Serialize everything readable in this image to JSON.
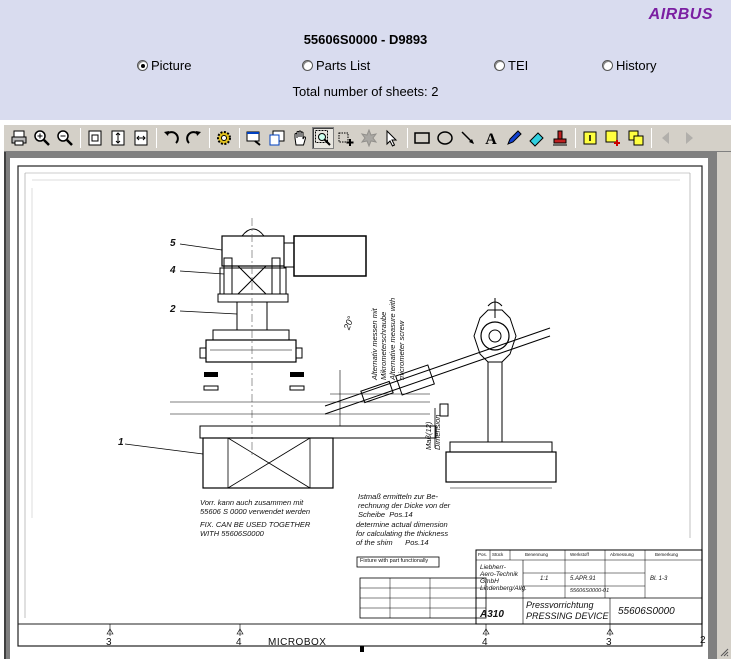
{
  "header": {
    "brand": "AIRBUS",
    "doc_title": "55606S0000 - D9893",
    "sheets_text": "Total number of sheets: 2"
  },
  "view_tabs": [
    {
      "label": "Picture",
      "selected": true
    },
    {
      "label": "Parts List",
      "selected": false
    },
    {
      "label": "TEI",
      "selected": false
    },
    {
      "label": "History",
      "selected": false
    }
  ],
  "drawing": {
    "item_numbers": [
      "5",
      "4",
      "2",
      "1"
    ],
    "note_de_fix": "Vorr. kann auch zusammen mit\n55606 S 0000 verwendet werden",
    "note_en_fix": "FIX. CAN BE USED TOGETHER\nWITH 55606S0000",
    "note_de_measure": "Istmaß ermitteln zur Be-\nrechnung der Dicke von der\nScheibe  Pos.14",
    "note_en_measure": "determine actual dimension\nfor calculating the thickness\nof the shim      Pos.14",
    "note_alt_measure": "Alternativ messen mit\nMikrometerschraube\nAlternative measure with\nmicrometer screw",
    "dim_label": "Maß(12)\nDimension",
    "angle_label": "20°",
    "fixture_label": "Fixture with part functionally",
    "title_block": {
      "company": "Liebherr-\nAero-Technik\nGmbH\nLindenberg/Allg.",
      "aircraft": "A310",
      "title_de": "Pressvorrichtung",
      "title_en": "PRESSING DEVICE",
      "part_number": "55606S0000",
      "col_pos": "Pos.",
      "col_qty": "Stück",
      "col_name": "Benennung",
      "col_material": "Werkstoff",
      "col_dim": "Abmessung",
      "col_remark": "Bemerkung",
      "sheet_label": "Bl. 1-3",
      "date_label": "5.APR.91",
      "scale_label": "1:1",
      "drawing_no": "55606S0000-01"
    },
    "bottom_strip": {
      "zone_marks": [
        "3",
        "4",
        "4",
        "3",
        "2"
      ],
      "microbox_label": "MICROBOX"
    }
  },
  "colors": {
    "header_bg": "#d9dcef",
    "brand": "#7b1fa2",
    "toolbar_bg": "#d4d0c8",
    "viewer_bg": "#808080"
  },
  "toolbar_icons": [
    "print-icon",
    "zoom-in-icon",
    "zoom-out-icon",
    "fit-page-icon",
    "fit-height-icon",
    "fit-width-icon",
    "rotate-left-icon",
    "rotate-right-icon",
    "settings-icon",
    "magnifier-window-icon",
    "overview-icon",
    "pan-icon",
    "zoom-area-icon",
    "add-markup-icon",
    "stamp-icon",
    "select-icon",
    "rectangle-icon",
    "ellipse-icon",
    "line-icon",
    "text-icon",
    "pen-icon",
    "highlight-icon",
    "redline-icon",
    "note-icon",
    "note-add-icon",
    "note-copy-icon",
    "previous-page-icon",
    "next-page-icon"
  ]
}
